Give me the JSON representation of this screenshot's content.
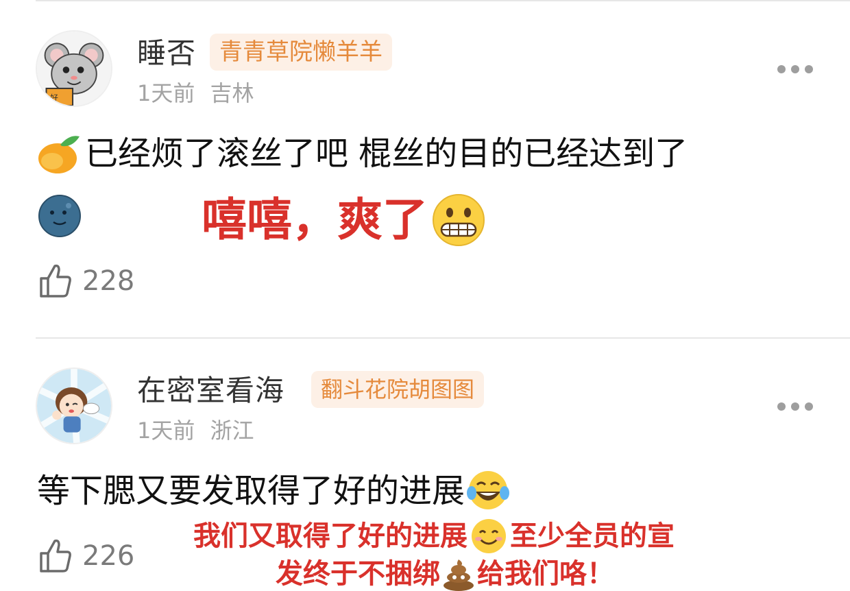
{
  "comments": [
    {
      "username": "睡否",
      "badge": "青青草院懒羊羊",
      "time": "1天前",
      "location": "吉林",
      "text": "已经烦了滚丝了吧 棍丝的目的已经达到了",
      "likes": "228",
      "overlay_text": "嘻嘻，爽了"
    },
    {
      "username": "在密室看海",
      "badge": "翻斗花院胡图图",
      "time": "1天前",
      "location": "浙江",
      "text": "等下腮又要发取得了好的进展",
      "likes": "226",
      "overlay_line1_a": "我们又取得了好的进展",
      "overlay_line1_b": "至少全员的宣",
      "overlay_line2_a": "发终于不捆绑",
      "overlay_line2_b": "给我们咯！"
    }
  ],
  "colors": {
    "badge_bg": "#fdf0e6",
    "badge_text": "#e58a3c",
    "overlay_red": "#d9312b",
    "meta_gray": "#a3a3a3"
  },
  "icons": [
    "mouse-avatar",
    "girl-avatar",
    "more-icon",
    "like-icon",
    "mango-emoji",
    "moon-face-emoji",
    "grimace-emoji",
    "laugh-tears-emoji",
    "smile-emoji",
    "poop-emoji"
  ]
}
